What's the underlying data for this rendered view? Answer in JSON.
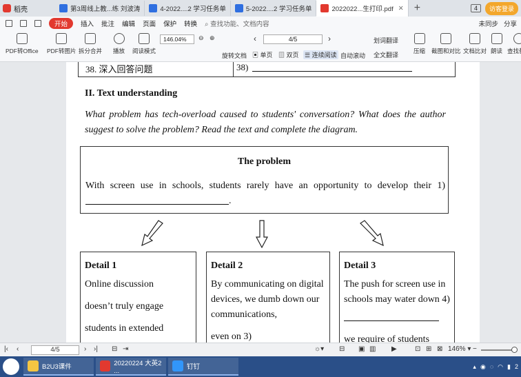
{
  "tabs": {
    "app_name": "稻壳",
    "items": [
      {
        "label": "第3周线上教...练  刘波涛",
        "kind": "w",
        "active": false
      },
      {
        "label": "4-2022....2 学习任务单",
        "kind": "w",
        "active": false
      },
      {
        "label": "5-2022....2 学习任务单",
        "kind": "w",
        "active": false
      },
      {
        "label": "2022022...生打印.pdf",
        "kind": "p",
        "active": true
      }
    ],
    "add": "+",
    "window_count": "4",
    "visitor_login": "访客登录"
  },
  "menu": {
    "start": "开始",
    "items": [
      "插入",
      "批注",
      "编辑",
      "页面",
      "保护",
      "转换"
    ],
    "search": "查找功能、文档内容",
    "unsynced": "未同步",
    "share": "分享"
  },
  "ribbon": {
    "buttons": [
      "PDF转Office",
      "PDF转图片",
      "拆分合并",
      "播放",
      "阅读模式"
    ],
    "zoom": "146.04%",
    "page": "4/5",
    "rotate": "旋转文档",
    "single": "单页",
    "double": "双页",
    "continuous": "连续阅读",
    "auto_scroll": "自动滚动",
    "translate": "划词翻译",
    "full_translate": "全文翻译",
    "right_buttons": [
      "压缩",
      "截图和对比",
      "文档比对",
      "朗读",
      "查找替换"
    ]
  },
  "document": {
    "table_row": {
      "left": "38.  深入回答问题",
      "right": "38)"
    },
    "section_title": "II. Text understanding",
    "instructions": "What problem has tech-overload caused to students' conversation? What does the author suggest to solve the problem? Read the text and complete the diagram.",
    "problem": {
      "heading": "The problem",
      "text": "With screen use in schools, students rarely have an opportunity to develop their 1)",
      "end": "."
    },
    "details": [
      {
        "heading": "Detail 1",
        "paras": [
          "Online discussion",
          "doesn’t truly engage",
          "students in extended"
        ]
      },
      {
        "heading": "Detail 2",
        "paras": [
          "By communicating on digital devices, we dumb down our communications,",
          "even on 3)"
        ]
      },
      {
        "heading": "Detail 3",
        "paras": [
          "The push for screen use in schools may water down 4)",
          "we require of students"
        ]
      }
    ]
  },
  "statusbar": {
    "page": "4/5",
    "zoom": "146%"
  },
  "taskbar": {
    "items": [
      "B2U3课件",
      "20220224 大英2 ...",
      "钉钉"
    ],
    "time": "2"
  }
}
